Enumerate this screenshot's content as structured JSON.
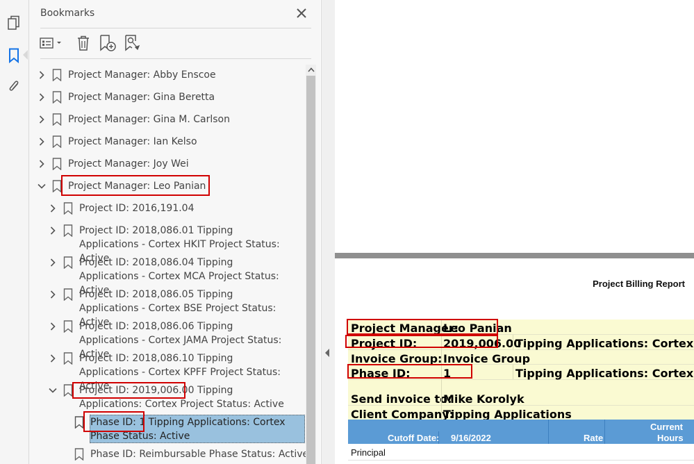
{
  "panel": {
    "title": "Bookmarks"
  },
  "bookmarks": [
    {
      "label": "Project Manager: Abby Enscoe"
    },
    {
      "label": "Project Manager: Gina Beretta"
    },
    {
      "label": "Project Manager: Gina M. Carlson"
    },
    {
      "label": "Project Manager: Ian Kelso"
    },
    {
      "label": "Project Manager: Joy Wei"
    },
    {
      "label": "Project Manager: Leo Panian"
    },
    {
      "label": "Project ID: 2016,191.04"
    },
    {
      "label": "Project ID: 2018,086.01 Tipping Applications - Cortex HKIT Project Status: Active"
    },
    {
      "label": "Project ID: 2018,086.04 Tipping Applications - Cortex MCA Project Status: Active"
    },
    {
      "label": "Project ID: 2018,086.05 Tipping Applications - Cortex BSE Project Status: Active"
    },
    {
      "label": "Project ID: 2018,086.06 Tipping Applications - Cortex JAMA Project Status: Active"
    },
    {
      "label": "Project ID: 2018,086.10 Tipping Applications - Cortex KPFF Project Status: Active"
    },
    {
      "label": "Project ID: 2019,006.00 Tipping Applications: Cortex Project Status: Active"
    },
    {
      "label": "Phase ID: 1 Tipping Applications: Cortex Phase Status: Active"
    },
    {
      "label": "Phase ID: Reimbursable Phase Status: Active"
    }
  ],
  "report": {
    "title": "Project Billing Report",
    "rows": [
      {
        "label": "Project Manager:",
        "value": "Leo Panian",
        "extra": ""
      },
      {
        "label": "Project ID:",
        "value": "2019,006.00",
        "extra": "Tipping Applications: Cortex"
      },
      {
        "label": "Invoice Group:",
        "value": "Invoice Group",
        "extra": ""
      },
      {
        "label": "Phase ID:",
        "value": "1",
        "extra": "Tipping Applications: Cortex"
      },
      {
        "label": "Send invoice to:",
        "value": "Mike Korolyk",
        "extra": ""
      },
      {
        "label": "Client Company:",
        "value": "Tipping Applications",
        "extra": ""
      }
    ],
    "header": {
      "cutoff_label": "Cutoff Date:",
      "cutoff_value": "9/16/2022",
      "rate": "Rate",
      "current": "Current",
      "hours": "Hours"
    },
    "section": "Principal"
  },
  "colors": {
    "highlight_box": "#d00000",
    "selection": "#99c1de",
    "table_header": "#5b9bd5",
    "info_bg": "#fafad2"
  }
}
